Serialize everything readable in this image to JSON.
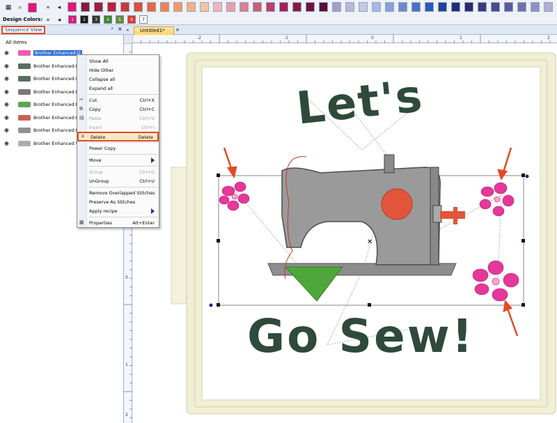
{
  "toolbar": {
    "palette_colors": [
      "#e0167a",
      "#8b1a3a",
      "#9c1f3b",
      "#b82238",
      "#c83a3a",
      "#d94f3e",
      "#e06a44",
      "#e8835a",
      "#f09a6b",
      "#f2b08c",
      "#f4c4a8",
      "#efb8b8",
      "#e8a0a8",
      "#d98090",
      "#c86078",
      "#b8406a",
      "#a42058",
      "#8a1848",
      "#6f1040",
      "#5a0c38",
      "#a0a0c8",
      "#b8b8d8",
      "#c8c8e0",
      "#a8b8e0",
      "#8aa0d8",
      "#6a88d0",
      "#4a70c8",
      "#2a58c0",
      "#2040a0",
      "#183080",
      "#2a2a70",
      "#3a3a80",
      "#4a4a90",
      "#5a5aa0",
      "#7070b0",
      "#9090c0",
      "#b0b0d0"
    ],
    "design_colors_label": "Design Colors:",
    "design_colors": [
      {
        "label": "1",
        "color": "#e0167a"
      },
      {
        "label": "2",
        "color": "#1a1a1a"
      },
      {
        "label": "3",
        "color": "#2a3a2a"
      },
      {
        "label": "4",
        "color": "#3a8a2a"
      },
      {
        "label": "5",
        "color": "#6a8a3a"
      },
      {
        "label": "6",
        "color": "#e03a2a"
      },
      {
        "label": "7",
        "color": "#ffffff"
      }
    ]
  },
  "sequence_view": {
    "title": "Sequence View",
    "pin": "ᵖ",
    "close": "×",
    "all_items": "All items",
    "items": [
      {
        "label": "Brother Enhanced:D",
        "selected": true
      },
      {
        "label": "Brother Enhanced:Da",
        "selected": false
      },
      {
        "label": "Brother Enhanced:Ca",
        "selected": false
      },
      {
        "label": "Brother Enhanced:Bl",
        "selected": false
      },
      {
        "label": "Brother Enhanced:M",
        "selected": false
      },
      {
        "label": "Brother Enhanced:Fl",
        "selected": false
      },
      {
        "label": "Brother Enhanced:B",
        "selected": false
      },
      {
        "label": "Brother Enhanced:W",
        "selected": false
      }
    ]
  },
  "context_menu": {
    "items": [
      {
        "label": "Show All",
        "shortcut": "",
        "disabled": false,
        "submenu": false,
        "icon": ""
      },
      {
        "label": "Hide Other",
        "shortcut": "",
        "disabled": false,
        "submenu": false,
        "icon": ""
      },
      {
        "label": "Collapse all",
        "shortcut": "",
        "disabled": false,
        "submenu": false,
        "icon": ""
      },
      {
        "label": "Expand all",
        "shortcut": "",
        "disabled": false,
        "submenu": false,
        "icon": ""
      },
      {
        "label": "Cut",
        "shortcut": "Ctrl+X",
        "disabled": false,
        "submenu": false,
        "icon": "✂"
      },
      {
        "label": "Copy",
        "shortcut": "Ctrl+C",
        "disabled": false,
        "submenu": false,
        "icon": "⧉"
      },
      {
        "label": "Paste",
        "shortcut": "Ctrl+V",
        "disabled": true,
        "submenu": false,
        "icon": "▤"
      },
      {
        "label": "Insert",
        "shortcut": "Ctrl+I",
        "disabled": true,
        "submenu": false,
        "icon": ""
      },
      {
        "label": "Delete",
        "shortcut": "Delete",
        "disabled": false,
        "submenu": false,
        "icon": "✕",
        "highlight": true
      },
      {
        "label": "Power Copy",
        "shortcut": "",
        "disabled": false,
        "submenu": false,
        "icon": ""
      },
      {
        "label": "Move",
        "shortcut": "",
        "disabled": false,
        "submenu": true,
        "icon": ""
      },
      {
        "label": "Group",
        "shortcut": "Ctrl+G",
        "disabled": true,
        "submenu": false,
        "icon": ""
      },
      {
        "label": "UnGroup",
        "shortcut": "Ctrl+U",
        "disabled": false,
        "submenu": false,
        "icon": ""
      },
      {
        "label": "Remove Overlapped Stitches",
        "shortcut": "",
        "disabled": false,
        "submenu": false,
        "icon": ""
      },
      {
        "label": "Preserve As Stitches",
        "shortcut": "",
        "disabled": false,
        "submenu": false,
        "icon": ""
      },
      {
        "label": "Apply recipe",
        "shortcut": "",
        "disabled": false,
        "submenu": true,
        "icon": ""
      },
      {
        "label": "Properties",
        "shortcut": "Alt+Enter",
        "disabled": false,
        "submenu": false,
        "icon": "▦"
      }
    ]
  },
  "document": {
    "tab_title": "Untitled1*",
    "tab_close": "×",
    "ruler_top": [
      "-2",
      "-1",
      "0",
      "1",
      "2"
    ],
    "ruler_left": [
      "-2",
      "-1",
      "0",
      "1",
      "2"
    ],
    "design_text_top": "Let's",
    "design_text_bottom": "Go Sew!"
  },
  "colors": {
    "accent_highlight": "#e24a25",
    "hoop_frame": "#f1f0d6",
    "stitch_dark": "#2f4a3a",
    "flower_pink": "#e6379a"
  }
}
